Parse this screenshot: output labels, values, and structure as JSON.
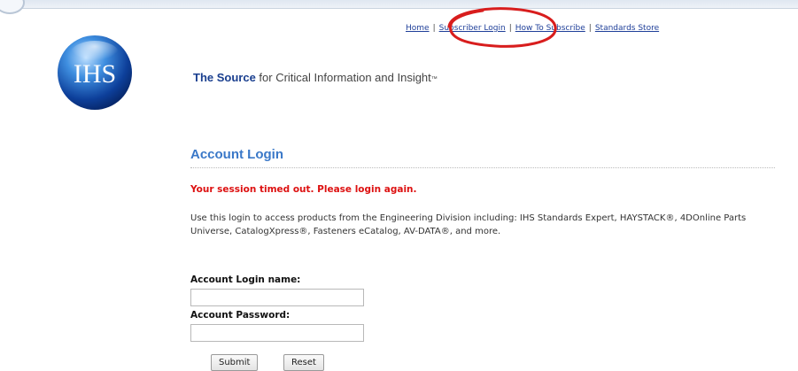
{
  "nav": {
    "home": "Home",
    "subscriber_login": "Subscriber Login",
    "how_to_subscribe": "How To Subscribe",
    "standards_store": "Standards Store",
    "separator": "|"
  },
  "logo": {
    "text": "IHS"
  },
  "tagline": {
    "brand": "The Source",
    "rest": " for Critical Information and Insight",
    "trademark": "™"
  },
  "login": {
    "title": "Account Login",
    "error": "Your session timed out. Please login again.",
    "description": "Use this login to access products from the Engineering Division including:  IHS Standards Expert, HAYSTACK®, 4DOnline Parts Universe, CatalogXpress®, Fasteners eCatalog, AV-DATA®, and more.",
    "name_label": "Account Login name:",
    "name_value": "",
    "password_label": "Account Password:",
    "password_value": "",
    "submit": "Submit",
    "reset": "Reset"
  },
  "colors": {
    "title_blue": "#3a78c8",
    "error_red": "#dd1111",
    "annotation_red": "#d81d1d",
    "link_blue": "#1f3f99"
  }
}
